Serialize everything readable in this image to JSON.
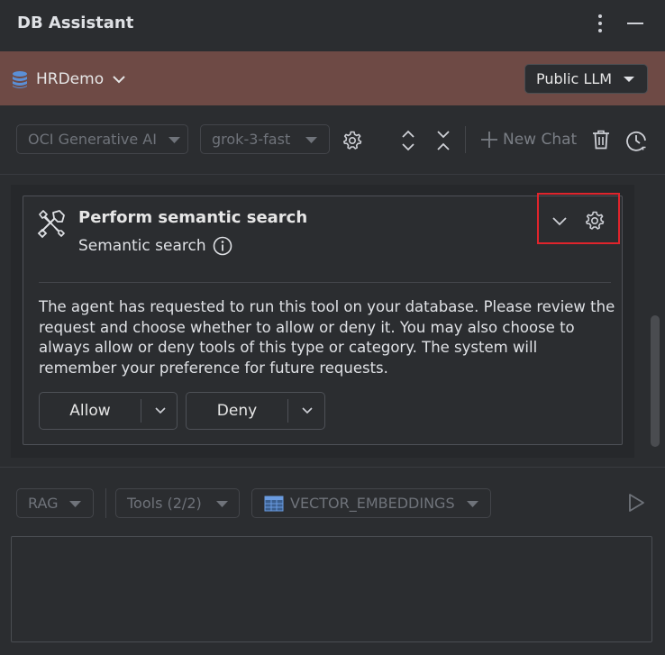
{
  "window": {
    "title": "DB Assistant"
  },
  "connection": {
    "name": "HRDemo",
    "llm_mode": "Public LLM"
  },
  "toolbar": {
    "provider": "OCI Generative AI",
    "model": "grok-3-fast",
    "new_chat_label": "New Chat"
  },
  "tool_request": {
    "title": "Perform semantic search",
    "subtitle": "Semantic search",
    "body": "The agent has requested to run this tool on your database. Please review the request and choose whether to allow or deny it. You may also choose to always allow or deny tools of this type or category. The system will remember your preference for future requests.",
    "allow_label": "Allow",
    "deny_label": "Deny"
  },
  "input_bar": {
    "rag_label": "RAG",
    "tools_label": "Tools (2/2)",
    "vector_table": "VECTOR_EMBEDDINGS"
  },
  "colors": {
    "background": "#2b2d30",
    "connection_band": "#6e4a45",
    "highlight": "#e0242c",
    "db_icon": "#5b8fd6"
  },
  "icons": [
    "more-vertical-icon",
    "minimize-icon",
    "database-icon",
    "chevron-down-icon",
    "gear-icon",
    "expand-icon",
    "collapse-icon",
    "plus-icon",
    "trash-icon",
    "history-icon",
    "tools-icon",
    "info-icon",
    "table-icon",
    "send-icon"
  ]
}
